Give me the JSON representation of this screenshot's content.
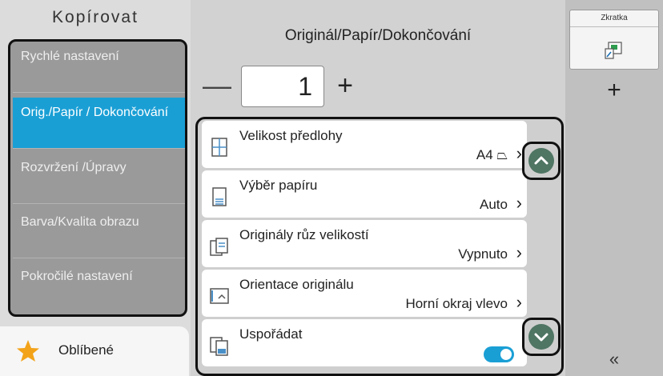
{
  "app": {
    "title": "Kopírovat"
  },
  "sidebar": {
    "items": [
      {
        "label": "Rychlé nastavení"
      },
      {
        "label": "Orig./Papír / Dokončování"
      },
      {
        "label": "Rozvržení /Úpravy"
      },
      {
        "label": "Barva/Kvalita obrazu"
      },
      {
        "label": "Pokročilé nastavení"
      }
    ],
    "favorites": {
      "label": "Oblíbené",
      "icon": "star-icon",
      "color": "#f3a31a"
    }
  },
  "main": {
    "title": "Originál/Papír/Dokončování",
    "quantity": {
      "minus": "—",
      "value": "1",
      "plus": "+"
    },
    "settings": [
      {
        "label": "Velikost předlohy",
        "value": "A4 ⏢",
        "icon": "original-size-icon"
      },
      {
        "label": "Výběr papíru",
        "value": "Auto",
        "icon": "paper-select-icon"
      },
      {
        "label": "Originály růz velikostí",
        "value": "Vypnuto",
        "icon": "mixed-size-icon"
      },
      {
        "label": "Orientace originálu",
        "value": "Horní okraj vlevo",
        "icon": "orientation-icon"
      },
      {
        "label": "Uspořádat",
        "value": "",
        "icon": "collate-icon",
        "toggle": true
      }
    ],
    "chevron": "›",
    "scroll": {
      "up_icon": "chevron-up-icon",
      "down_icon": "chevron-down-icon"
    }
  },
  "shortcut": {
    "title": "Zkratka",
    "add": "+",
    "collapse": "«"
  },
  "colors": {
    "accent": "#1a9fd5",
    "scroll_button": "#4f7563"
  }
}
